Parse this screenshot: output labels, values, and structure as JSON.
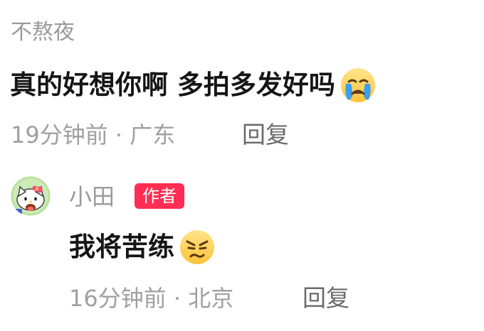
{
  "comment": {
    "username": "不熬夜",
    "text": "真的好想你啊 多拍多发好吗",
    "emoji": "crying-face-icon",
    "time": "19分钟前 · 广东",
    "reply_label": "回复"
  },
  "reply": {
    "avatar": "hello-kitty-avatar",
    "username": "小田",
    "badge": "作者",
    "text": "我将苦练",
    "emoji": "determined-face-icon",
    "time": "16分钟前 · 北京",
    "reply_label": "回复"
  },
  "colors": {
    "badge": "#ff2d52",
    "username": "#9a9a9a",
    "meta": "#a0a0a0",
    "reply": "#6a6a6a"
  }
}
